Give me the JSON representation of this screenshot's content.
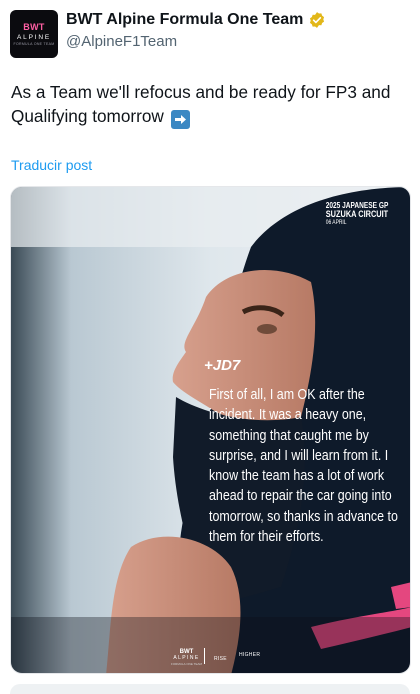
{
  "header": {
    "avatar": {
      "brand": "BWT",
      "team": "ALPINE",
      "subtitle": "FORMULA ONE TEAM"
    },
    "display_name": "BWT Alpine Formula One Team",
    "handle": "@AlpineF1Team",
    "verified_icon": "verified-badge-gold"
  },
  "tweet": {
    "text": "As a Team we'll refocus and be ready for FP3 and Qualifying tomorrow",
    "emoji": "right-arrow-emoji",
    "translate_label": "Traducir post"
  },
  "media": {
    "race_info": {
      "line1": "2025 JAPANESE GP",
      "line2": "SUZUKA CIRCUIT",
      "line3": "06 APRIL"
    },
    "driver_mark": "+JD7",
    "quote": "First of all, I am OK after the incident. It was a heavy one, something that caught me by surprise, and I will learn from it. I know the team has a lot of work ahead to repair the car going into tomorrow, so thanks in advance to them for their efforts.",
    "footer": {
      "brand": "BWT",
      "team": "ALPINE",
      "subtitle": "FORMULA ONE TEAM",
      "tag_rise": "RISE",
      "tag_higher": "HIGHER"
    }
  },
  "colors": {
    "link": "#1d9bf0",
    "handle": "#536471",
    "text": "#0f1419",
    "verified": "#e2b719",
    "emoji_bg": "#3b88c3"
  }
}
